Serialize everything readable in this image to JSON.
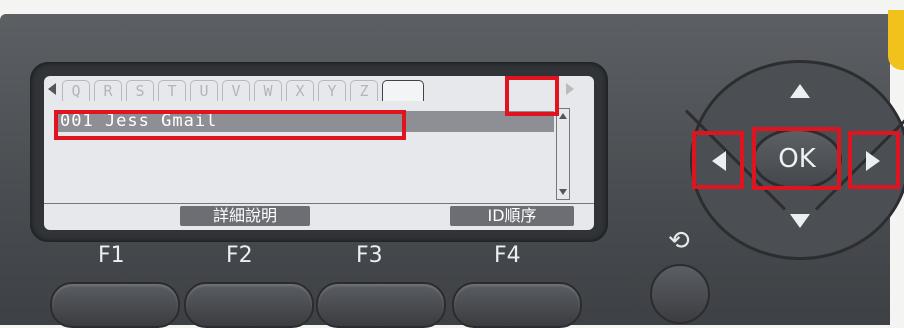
{
  "lcd": {
    "tabs": [
      "Q",
      "R",
      "S",
      "T",
      "U",
      "V",
      "W",
      "X",
      "Y",
      "Z",
      ""
    ],
    "selected_tab_index": 10,
    "list_items": [
      "001 Jess Gmail"
    ],
    "selected_item_index": 0,
    "softkeys": {
      "f1": "",
      "f2": "詳細說明",
      "f3": "",
      "f4": "ID順序"
    }
  },
  "function_keys": [
    "F1",
    "F2",
    "F3",
    "F4"
  ],
  "nav": {
    "ok_label": "OK"
  },
  "icons": {
    "back": "back-icon",
    "up": "arrow-up-icon",
    "down": "arrow-down-icon",
    "left": "arrow-left-icon",
    "right": "arrow-right-icon"
  },
  "highlight_color": "#e0141e"
}
